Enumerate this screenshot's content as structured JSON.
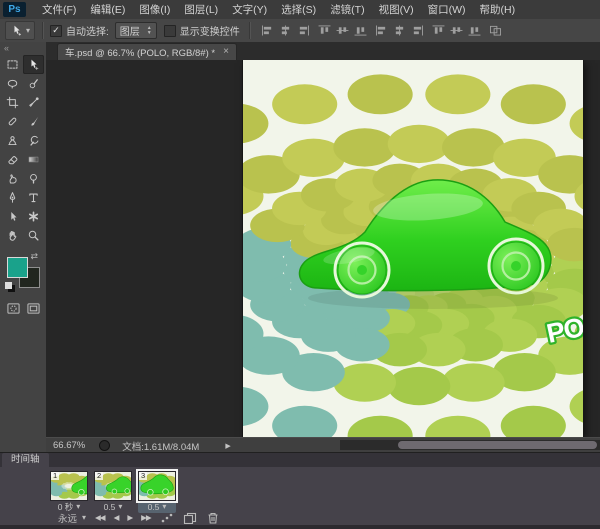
{
  "menu_bar": {
    "logo": "Ps",
    "items": [
      {
        "label": "文件(F)"
      },
      {
        "label": "编辑(E)"
      },
      {
        "label": "图像(I)"
      },
      {
        "label": "图层(L)"
      },
      {
        "label": "文字(Y)"
      },
      {
        "label": "选择(S)"
      },
      {
        "label": "滤镜(T)"
      },
      {
        "label": "视图(V)"
      },
      {
        "label": "窗口(W)"
      },
      {
        "label": "帮助(H)"
      }
    ]
  },
  "options_bar": {
    "active_tool": "move-tool",
    "auto_select": {
      "label": "自动选择:",
      "checked": true
    },
    "target_select": {
      "value": "图层"
    },
    "show_transform": {
      "label": "显示变换控件",
      "checked": false
    }
  },
  "document_window": {
    "tab": {
      "title": "车.psd @ 66.7% (POLO, RGB/8#) *",
      "close_glyph": "×"
    },
    "status_bar": {
      "zoom": "66.67%",
      "info": "文档:1.61M/8.04M"
    }
  },
  "toolbar": {
    "tools": [
      "rectangular-marquee",
      "move",
      "lasso",
      "quick-selection",
      "crop",
      "eyedropper",
      "spot-healing-brush",
      "brush",
      "clone-stamp",
      "history-brush",
      "eraser",
      "gradient",
      "smudge",
      "dodge",
      "pen",
      "type",
      "path-selection",
      "custom-shape",
      "hand",
      "zoom"
    ],
    "foreground_color": "#1aa28b",
    "background_color": "#21261f"
  },
  "canvas": {
    "watermark_text": "PO",
    "background": "#f2f5ea",
    "car_color": "#2fd01f",
    "dot_colors": {
      "olive": "#b9c24e",
      "lime": "#a4c94a",
      "teal": "#7fbcae",
      "pale": "#eff2e4"
    }
  },
  "timeline": {
    "tab_label": "时间轴",
    "loop_label": "永远",
    "frames": [
      {
        "number": "1",
        "delay": "0 秒",
        "selected": false
      },
      {
        "number": "2",
        "delay": "0.5",
        "selected": false
      },
      {
        "number": "3",
        "delay": "0.5",
        "selected": true
      }
    ]
  },
  "glyphs": {
    "caret_down": "▾",
    "double_chevron": "«",
    "swap_arrows": "⇄",
    "check": "✓",
    "popup_arrow": "▶",
    "first_frame": "◀◀",
    "prev_frame": "◀",
    "play": "▶",
    "next_frame": "▶▶",
    "spinner_up": "▲",
    "spinner_down": "▼"
  }
}
